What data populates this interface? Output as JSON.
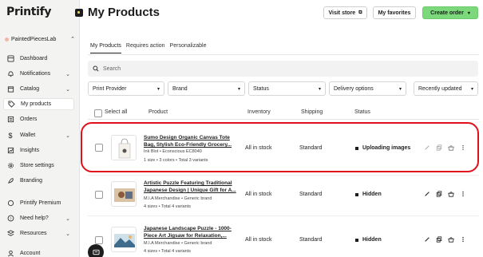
{
  "app": {
    "logo": "Printify"
  },
  "sidebar": {
    "store_name": "PaintedPiecesLab",
    "items": [
      {
        "label": "Dashboard",
        "icon": "dashboard-icon"
      },
      {
        "label": "Notifications",
        "icon": "bell-icon",
        "has_chevron": true
      },
      {
        "label": "Catalog",
        "icon": "catalog-icon",
        "has_chevron": true
      },
      {
        "label": "My products",
        "icon": "tag-icon",
        "active": true
      },
      {
        "label": "Orders",
        "icon": "orders-icon"
      },
      {
        "label": "Wallet",
        "icon": "dollar-icon",
        "has_chevron": true
      },
      {
        "label": "Insights",
        "icon": "insights-icon"
      },
      {
        "label": "Store settings",
        "icon": "gear-icon"
      },
      {
        "label": "Branding",
        "icon": "branding-icon"
      },
      {
        "label": "Printify Premium",
        "icon": "crown-icon"
      },
      {
        "label": "Need help?",
        "icon": "help-icon",
        "has_chevron": true
      },
      {
        "label": "Resources",
        "icon": "resources-icon",
        "has_chevron": true
      },
      {
        "label": "Account",
        "icon": "account-icon"
      }
    ]
  },
  "header": {
    "title": "My Products",
    "visit_store": "Visit store",
    "my_favorites": "My favorites",
    "create_order": "Create order"
  },
  "tabs": [
    "My Products",
    "Requires action",
    "Personalizable"
  ],
  "search": {
    "placeholder": "Search"
  },
  "filters": {
    "print_provider": "Print Provider",
    "brand": "Brand",
    "status": "Status",
    "delivery": "Delivery options",
    "sort": "Recently updated"
  },
  "table": {
    "select_all": "Select all",
    "columns": {
      "product": "Product",
      "inventory": "Inventory",
      "shipping": "Shipping",
      "status": "Status"
    },
    "rows": [
      {
        "title": "Sumo Design Organic Canvas Tote Bag, Stylish Eco-Friendly Grocery...",
        "brand": "Ink Blot • Econscious EC8040",
        "meta": "1 size • 3 colors • Total 3 variants",
        "inventory": "All in stock",
        "shipping": "Standard",
        "status": "Uploading images"
      },
      {
        "title": "Artistic Puzzle Featuring Traditional Japanese Design | Unique Gift for A...",
        "brand": "M.I.A Merchandise • Generic brand",
        "meta": "4 sizes • Total 4 variants",
        "inventory": "All in stock",
        "shipping": "Standard",
        "status": "Hidden"
      },
      {
        "title": "Japanese Landscape Puzzle - 1000-Piece Art Jigsaw for Relaxation,...",
        "brand": "M.I.A Merchandise • Generic brand",
        "meta": "4 sizes • Total 4 variants",
        "inventory": "All in stock",
        "shipping": "Standard",
        "status": "Hidden"
      }
    ]
  },
  "colors": {
    "accent": "#7bd87b",
    "highlight": "#e0101a",
    "sidebar_bg": "#f3f3f1"
  }
}
